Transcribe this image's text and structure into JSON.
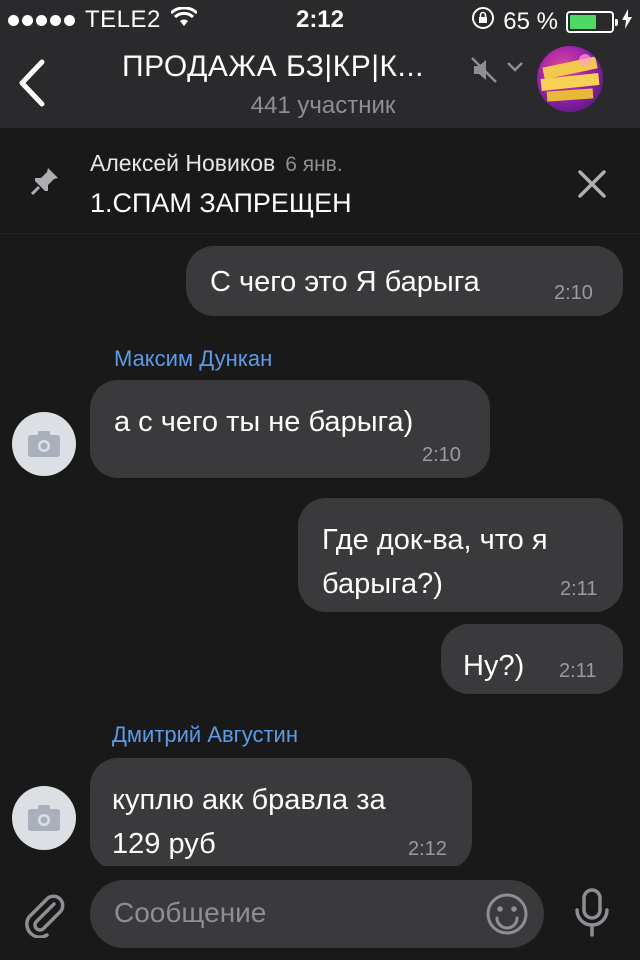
{
  "status_bar": {
    "carrier": "TELE2",
    "time": "2:12",
    "battery_percent": "65 %",
    "battery_level": 0.65
  },
  "header": {
    "title": "ПРОДАЖА БЗ|КР|К...",
    "subtitle": "441 участник",
    "icons": [
      "back-chevron-icon",
      "mute-icon",
      "chevron-down-icon",
      "group-avatar"
    ]
  },
  "pinned": {
    "author": "Алексей Новиков",
    "date": "6 янв.",
    "text": "1.СПАМ ЗАПРЕЩЕН"
  },
  "messages": [
    {
      "direction": "outgoing",
      "text": "С чего это Я барыга",
      "time": "2:10"
    },
    {
      "direction": "incoming",
      "sender": "Максим Дункан",
      "text": "а с чего ты не барыга)",
      "time": "2:10"
    },
    {
      "direction": "outgoing",
      "lines": [
        "Где док-ва, что я",
        "барыга?)"
      ],
      "time": "2:11"
    },
    {
      "direction": "outgoing",
      "text": "Ну?)",
      "time": "2:11"
    },
    {
      "direction": "incoming",
      "sender": "Дмитрий Августин",
      "lines": [
        "куплю акк бравла за",
        "129 руб"
      ],
      "time": "2:12"
    }
  ],
  "composer": {
    "placeholder": "Сообщение",
    "icons": [
      "attach-icon",
      "emoji-icon",
      "mic-icon"
    ]
  },
  "colors": {
    "background": "#19191a",
    "bar": "#2a2a2c",
    "bubble": "#3a3a3c",
    "sender_name": "#5a9ce8",
    "secondary_text": "#8e8e93",
    "battery": "#4cd964"
  }
}
